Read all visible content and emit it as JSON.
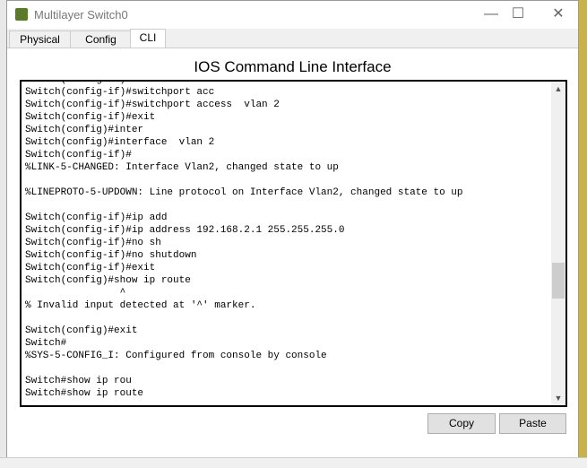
{
  "window": {
    "title": "Multilayer Switch0",
    "minimize": "—",
    "maximize": "☐",
    "close": "✕"
  },
  "tabs": [
    {
      "label": "Physical"
    },
    {
      "label": "Config"
    },
    {
      "label": "CLI",
      "active": true
    }
  ],
  "cli": {
    "heading": "IOS Command Line Interface",
    "lines": [
      "Switch(config-if)#swit",
      "Switch(config-if)#switchport acc",
      "Switch(config-if)#switchport access  vlan 2",
      "Switch(config-if)#exit",
      "Switch(config)#inter",
      "Switch(config)#interface  vlan 2",
      "Switch(config-if)#",
      "%LINK-5-CHANGED: Interface Vlan2, changed state to up",
      "",
      "%LINEPROTO-5-UPDOWN: Line protocol on Interface Vlan2, changed state to up",
      "",
      "Switch(config-if)#ip add",
      "Switch(config-if)#ip address 192.168.2.1 255.255.255.0",
      "Switch(config-if)#no sh",
      "Switch(config-if)#no shutdown",
      "Switch(config-if)#exit",
      "Switch(config)#show ip route",
      "                ^",
      "% Invalid input detected at '^' marker.",
      "",
      "Switch(config)#exit",
      "Switch#",
      "%SYS-5-CONFIG_I: Configured from console by console",
      "",
      "Switch#show ip rou",
      "Switch#show ip route"
    ],
    "copy_label": "Copy",
    "paste_label": "Paste"
  }
}
